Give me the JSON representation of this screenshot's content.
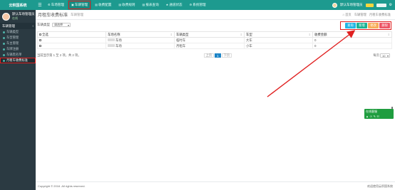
{
  "app": {
    "brand": "云积国系统"
  },
  "topnav": {
    "items": [
      {
        "label": "车场管理",
        "glyph": "⚙"
      },
      {
        "label": "车辆管理",
        "glyph": "▣"
      },
      {
        "label": "收费配置",
        "glyph": "▤"
      },
      {
        "label": "收费规则",
        "glyph": "▤"
      },
      {
        "label": "报表查询",
        "glyph": "▤"
      },
      {
        "label": "通道状态",
        "glyph": "★"
      },
      {
        "label": "系统管理",
        "glyph": "⚙"
      }
    ],
    "user_label": "默认车场管理员"
  },
  "sidebar": {
    "user_name": "默认车场管理员",
    "user_status": "在线",
    "menu_head": "车辆管理",
    "items": [
      {
        "label": "车辆类型"
      },
      {
        "label": "车型管理"
      },
      {
        "label": "车主管理"
      },
      {
        "label": "车牌注册"
      },
      {
        "label": "车辆黑名单"
      },
      {
        "label": "月租车收费标准"
      }
    ]
  },
  "page": {
    "title": "月租车收费标准",
    "tab": "车辆管理",
    "breadcrumbs": [
      "首页",
      "车辆管理",
      "月租车收费标准"
    ]
  },
  "filter": {
    "label": "车辆类型",
    "value": "请选择"
  },
  "toolbar": {
    "query": "查询",
    "add": "新增",
    "edit": "修改",
    "delete": "删除"
  },
  "table": {
    "select_all": "全选",
    "columns": [
      "车场名称",
      "车辆类型",
      "车型",
      "收费金额"
    ],
    "rows": [
      {
        "park": "车场",
        "type": "临时车",
        "model": "大车",
        "fee": "0"
      },
      {
        "park": "车场",
        "type": "月租车",
        "model": "小车",
        "fee": "0"
      }
    ]
  },
  "pagination": {
    "summary": "当前显示第 1 至 2 项，共 2 项。",
    "prev": "上页",
    "current": "1",
    "next": "下页",
    "per_page_label": "每页",
    "per_page": "10"
  },
  "widget": {
    "title": "在线客服",
    "actions": [
      "▲",
      "☉",
      "✎",
      "☷"
    ]
  },
  "footer": {
    "copyright": "Copyright © 2016 .All rights reserved.",
    "right_text": "欢迎使用云积国系统"
  },
  "colors": {
    "primary": "#1d9a8f",
    "sidebar": "#2b3a42",
    "highlight": "#e02020"
  }
}
